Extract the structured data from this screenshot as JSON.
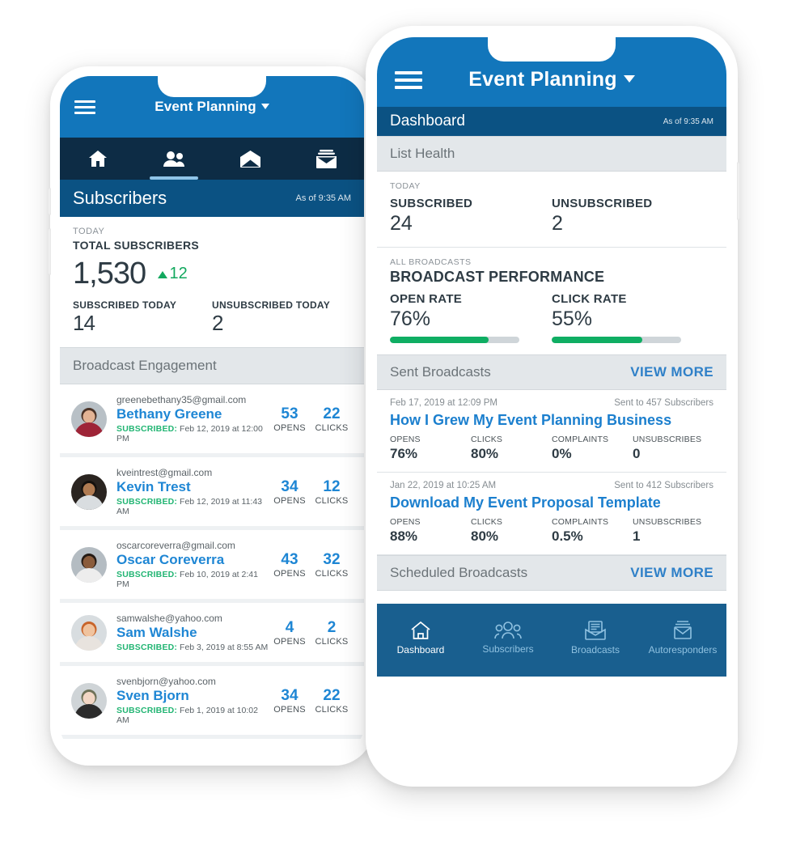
{
  "left_phone": {
    "appbar": {
      "menu_icon": "hamburger-icon",
      "title": "Event Planning",
      "caret_icon": "chevron-down-icon"
    },
    "tabs": [
      {
        "name": "home",
        "icon": "home-icon",
        "active": false
      },
      {
        "name": "subscribers",
        "icon": "people-icon",
        "active": true
      },
      {
        "name": "broadcasts",
        "icon": "open-envelope-icon",
        "active": false
      },
      {
        "name": "autoresponders",
        "icon": "stacked-envelope-icon",
        "active": false
      }
    ],
    "section": {
      "title": "Subscribers",
      "timestamp": "As of 9:35 AM"
    },
    "summary": {
      "kicker": "TODAY",
      "label": "TOTAL SUBSCRIBERS",
      "value": "1,530",
      "delta": "12",
      "subscribed_label": "SUBSCRIBED TODAY",
      "subscribed_value": "14",
      "unsubscribed_label": "UNSUBSCRIBED TODAY",
      "unsubscribed_value": "2"
    },
    "list_header": "Broadcast Engagement",
    "opens_label": "OPENS",
    "clicks_label": "CLICKS",
    "subscribed_prefix": "SUBSCRIBED",
    "subscribers": [
      {
        "email": "greenebethany35@gmail.com",
        "name": "Bethany Greene",
        "date": "Feb 12, 2019 at 12:00 PM",
        "opens": "53",
        "clicks": "22",
        "avatar_bg": "#b8c0c6",
        "skin": "#e3b394",
        "shirt": "#9e2437",
        "hair": "#4a3226"
      },
      {
        "email": "kveintrest@gmail.com",
        "name": "Kevin Trest",
        "date": "Feb 12, 2019 at 11:43 AM",
        "opens": "34",
        "clicks": "12",
        "avatar_bg": "#2a2420",
        "skin": "#b07b52",
        "shirt": "#d9dde0",
        "hair": "#14100d"
      },
      {
        "email": "oscarcoreverra@gmail.com",
        "name": "Oscar Coreverra",
        "date": "Feb 10, 2019 at 2:41 PM",
        "opens": "43",
        "clicks": "32",
        "avatar_bg": "#b4bcc2",
        "skin": "#8a5c3c",
        "shirt": "#ededed",
        "hair": "#241a14"
      },
      {
        "email": "samwalshe@yahoo.com",
        "name": "Sam Walshe",
        "date": "Feb 3, 2019 at 8:55 AM",
        "opens": "4",
        "clicks": "2",
        "avatar_bg": "#d8dde0",
        "skin": "#f0c39e",
        "shirt": "#e8e3de",
        "hair": "#c8642a"
      },
      {
        "email": "svenbjorn@yahoo.com",
        "name": "Sven Bjorn",
        "date": "Feb 1, 2019 at 10:02 AM",
        "opens": "34",
        "clicks": "22",
        "avatar_bg": "#cfd4d7",
        "skin": "#f2d6c4",
        "shirt": "#2b2b2b",
        "hair": "#6f7258"
      }
    ]
  },
  "right_phone": {
    "appbar": {
      "menu_icon": "hamburger-icon",
      "title": "Event Planning",
      "caret_icon": "chevron-down-icon"
    },
    "section": {
      "title": "Dashboard",
      "timestamp": "As of 9:35 AM"
    },
    "list_health": {
      "band_title": "List Health",
      "kicker": "TODAY",
      "subscribed_label": "SUBSCRIBED",
      "subscribed_value": "24",
      "unsubscribed_label": "UNSUBSCRIBED",
      "unsubscribed_value": "2"
    },
    "performance": {
      "kicker": "ALL BROADCASTS",
      "title": "BROADCAST PERFORMANCE",
      "open_rate_label": "OPEN RATE",
      "open_rate_value": "76%",
      "open_rate_pct": 76,
      "click_rate_label": "CLICK RATE",
      "click_rate_value": "55%",
      "click_rate_pct": 70,
      "bar_color": "#0fae63"
    },
    "sent": {
      "band_title": "Sent Broadcasts",
      "view_more": "VIEW MORE",
      "stat_labels": {
        "opens": "OPENS",
        "clicks": "CLICKS",
        "complaints": "COMPLAINTS",
        "unsubscribes": "UNSUBSCRIBES"
      },
      "items": [
        {
          "date": "Feb 17, 2019 at 12:09 PM",
          "sent_to": "Sent to 457 Subscribers",
          "title": "How I Grew My Event Planning Business",
          "opens": "76%",
          "clicks": "80%",
          "complaints": "0%",
          "unsubscribes": "0"
        },
        {
          "date": "Jan 22, 2019 at 10:25 AM",
          "sent_to": "Sent to 412 Subscribers",
          "title": "Download My Event Proposal Template",
          "opens": "88%",
          "clicks": "80%",
          "complaints": "0.5%",
          "unsubscribes": "1"
        }
      ]
    },
    "scheduled": {
      "band_title": "Scheduled Broadcasts",
      "view_more": "VIEW MORE"
    },
    "bottom_nav": [
      {
        "label": "Dashboard",
        "icon": "home-outline-icon",
        "active": true
      },
      {
        "label": "Subscribers",
        "icon": "people-outline-icon",
        "active": false
      },
      {
        "label": "Broadcasts",
        "icon": "open-envelope-outline-icon",
        "active": false
      },
      {
        "label": "Autoresponders",
        "icon": "stacked-envelope-outline-icon",
        "active": false
      }
    ]
  },
  "theme": {
    "appbar_blue": "#1276bb",
    "section_blue": "#0b5283",
    "tabbar_navy": "#0d2c45",
    "bottomnav_blue": "#195f8f",
    "link_blue": "#1e86d4",
    "green": "#12a85e",
    "band_gray": "#e3e7ea"
  }
}
